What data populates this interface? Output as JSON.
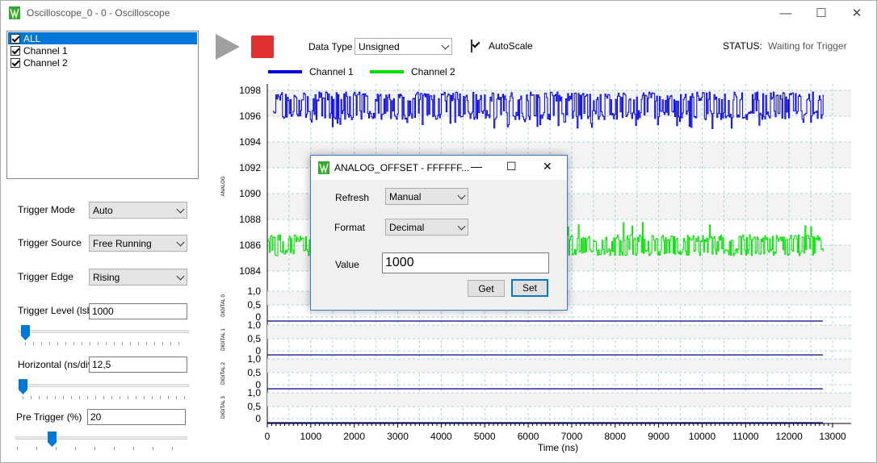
{
  "window": {
    "title": "Oscilloscope_0 - 0 - Oscilloscope",
    "minimize": "—",
    "maximize": "☐",
    "close": "✕"
  },
  "channels": [
    {
      "label": "ALL",
      "checked": true,
      "selected": true
    },
    {
      "label": "Channel 1",
      "checked": true,
      "selected": false
    },
    {
      "label": "Channel 2",
      "checked": true,
      "selected": false
    }
  ],
  "controls": {
    "trigger_mode": {
      "label": "Trigger Mode",
      "value": "Auto"
    },
    "trigger_source": {
      "label": "Trigger Source",
      "value": "Free Running"
    },
    "trigger_edge": {
      "label": "Trigger Edge",
      "value": "Rising"
    },
    "trigger_level": {
      "label": "Trigger Level (lsb)",
      "value": "1000"
    },
    "horizontal": {
      "label": "Horizontal (ns/div)",
      "value": "12,5"
    },
    "pre_trigger": {
      "label": "Pre Trigger (%)",
      "value": "20"
    }
  },
  "toolbar": {
    "data_type_label": "Data Type",
    "data_type_value": "Unsigned",
    "autoscale_label": "AutoScale",
    "status_label": "STATUS:",
    "status_value": "Waiting for Trigger"
  },
  "legend": [
    {
      "name": "Channel 1",
      "color": "#0000e0"
    },
    {
      "name": "Channel 2",
      "color": "#00e000"
    }
  ],
  "dialog": {
    "title": "ANALOG_OFFSET - FFFFFF...",
    "refresh_label": "Refresh",
    "refresh_value": "Manual",
    "format_label": "Format",
    "format_value": "Decimal",
    "value_label": "Value",
    "value": "1000",
    "get_button": "Get",
    "set_button": "Set"
  },
  "chart_data": {
    "type": "line",
    "xlabel": "Time (ns)",
    "xlim": [
      0,
      13000
    ],
    "x_ticks": [
      "0",
      "1000",
      "2000",
      "3000",
      "4000",
      "5000",
      "6000",
      "7000",
      "8000",
      "9000",
      "10000",
      "11000",
      "12000",
      "13000"
    ],
    "analog": {
      "ylabel": "ANALOG",
      "ylim": [
        1083,
        1098.5
      ],
      "y_ticks": [
        "1098",
        "1096",
        "1094",
        "1092",
        "1090",
        "1088",
        "1086",
        "1084"
      ],
      "series": [
        {
          "name": "Channel 1",
          "color": "#0000e0",
          "x_range": [
            130,
            12800
          ],
          "level": 1096.8,
          "spread": 1.2,
          "spikes_low": 1095
        },
        {
          "name": "Channel 2",
          "color": "#00e000",
          "x_range": [
            0,
            12800
          ],
          "level": 1086.0,
          "spread": 0.9,
          "spikes_high": 1087.8
        }
      ]
    },
    "digital": [
      {
        "ylabel": "DIGITAL 0",
        "y_ticks": [
          "1,0",
          "0,5",
          "0"
        ],
        "value": 0
      },
      {
        "ylabel": "DIGITAL 1",
        "y_ticks": [
          "1,0",
          "0,5",
          "0"
        ],
        "value": 0
      },
      {
        "ylabel": "DIGITAL 2",
        "y_ticks": [
          "1,0",
          "0,5",
          "0"
        ],
        "value": 0
      },
      {
        "ylabel": "DIGITAL 3",
        "y_ticks": [
          "1,0",
          "0,5",
          "0"
        ],
        "value": 0
      }
    ],
    "grid": true
  }
}
